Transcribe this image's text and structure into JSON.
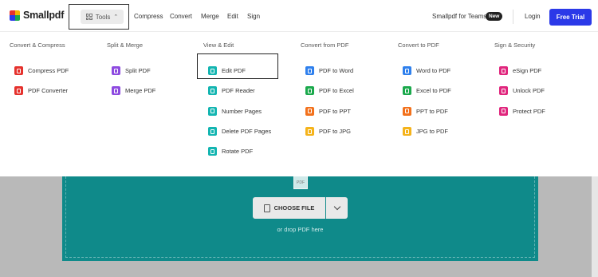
{
  "brand": {
    "name": "Smallpdf",
    "colors": [
      "#e5322d",
      "#f4b400",
      "#2b39e8",
      "#1ba94c"
    ]
  },
  "nav": {
    "tools_label": "Tools",
    "links": [
      "Compress",
      "Convert",
      "Merge",
      "Edit",
      "Sign"
    ],
    "teams_label": "Smallpdf for Teams",
    "new_badge": "New",
    "login_label": "Login",
    "trial_label": "Free Trial",
    "trial_color": "#2b39e8"
  },
  "menu": {
    "columns": [
      {
        "title": "Convert & Compress",
        "items": [
          {
            "label": "Compress PDF",
            "icon": "compress-icon",
            "color": "#e5322d"
          },
          {
            "label": "PDF Converter",
            "icon": "converter-icon",
            "color": "#e5322d"
          }
        ]
      },
      {
        "title": "Split & Merge",
        "items": [
          {
            "label": "Split PDF",
            "icon": "scissors-icon",
            "color": "#8e4be0"
          },
          {
            "label": "Merge PDF",
            "icon": "merge-icon",
            "color": "#8e4be0"
          }
        ]
      },
      {
        "title": "View & Edit",
        "items": [
          {
            "label": "Edit PDF",
            "icon": "edit-icon",
            "color": "#13b5b1"
          },
          {
            "label": "PDF Reader",
            "icon": "reader-icon",
            "color": "#13b5b1"
          },
          {
            "label": "Number Pages",
            "icon": "number-pages-icon",
            "color": "#13b5b1"
          },
          {
            "label": "Delete PDF Pages",
            "icon": "trash-icon",
            "color": "#13b5b1"
          },
          {
            "label": "Rotate PDF",
            "icon": "rotate-icon",
            "color": "#13b5b1"
          }
        ]
      },
      {
        "title": "Convert from PDF",
        "items": [
          {
            "label": "PDF to Word",
            "icon": "word-icon",
            "color": "#2f80ed"
          },
          {
            "label": "PDF to Excel",
            "icon": "excel-icon",
            "color": "#1ba94c"
          },
          {
            "label": "PDF to PPT",
            "icon": "ppt-icon",
            "color": "#f2711c"
          },
          {
            "label": "PDF to JPG",
            "icon": "jpg-icon",
            "color": "#f5b31b"
          }
        ]
      },
      {
        "title": "Convert to PDF",
        "items": [
          {
            "label": "Word to PDF",
            "icon": "word-icon",
            "color": "#2f80ed"
          },
          {
            "label": "Excel to PDF",
            "icon": "excel-icon",
            "color": "#1ba94c"
          },
          {
            "label": "PPT to PDF",
            "icon": "ppt-icon",
            "color": "#f2711c"
          },
          {
            "label": "JPG to PDF",
            "icon": "jpg-icon",
            "color": "#f5b31b"
          }
        ]
      },
      {
        "title": "Sign & Security",
        "items": [
          {
            "label": "eSign PDF",
            "icon": "esign-icon",
            "color": "#e0267d"
          },
          {
            "label": "Unlock PDF",
            "icon": "unlock-icon",
            "color": "#e0267d"
          },
          {
            "label": "Protect PDF",
            "icon": "shield-icon",
            "color": "#e0267d"
          }
        ]
      }
    ]
  },
  "upload": {
    "choose_label": "CHOOSE FILE",
    "drop_hint": "or drop PDF here",
    "pdf_tag": "PDF",
    "color": "#0f8a8a"
  }
}
